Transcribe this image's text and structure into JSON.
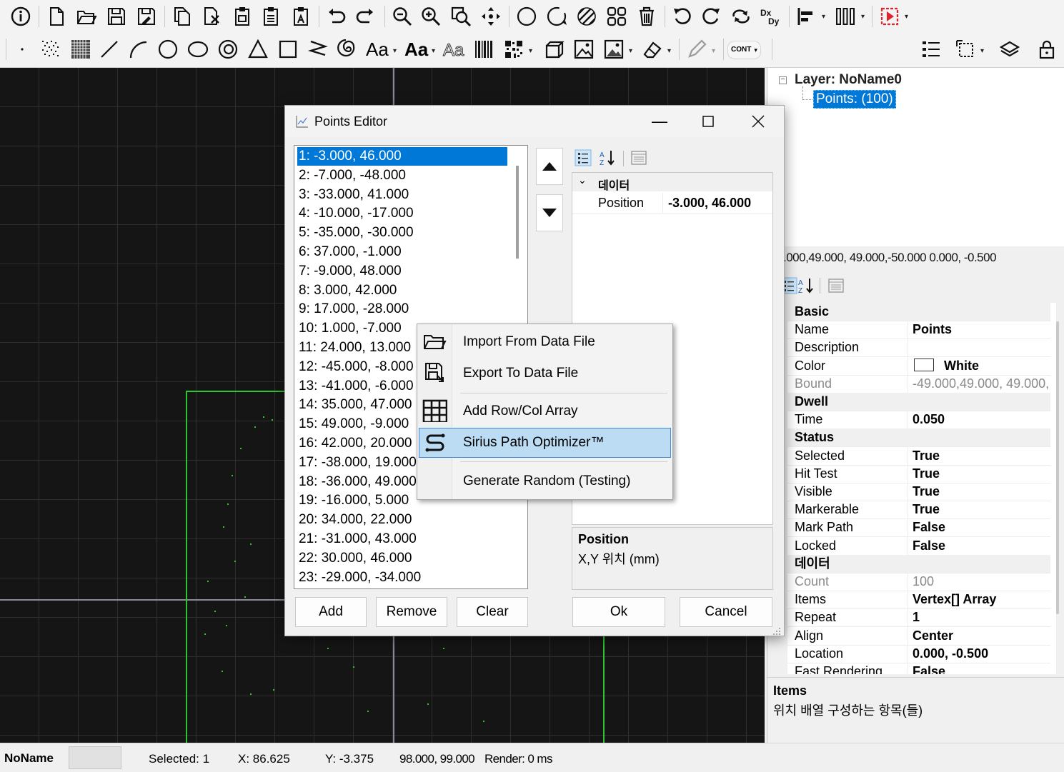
{
  "toolbar_top": {
    "icons": [
      "info-icon",
      "new-file-icon",
      "open-folder-icon",
      "save-icon",
      "save-as-icon",
      "copy-pages-icon",
      "cut-doc-icon",
      "paste-icon",
      "paste-special-icon",
      "paste-alt-icon",
      "undo-icon",
      "redo-icon",
      "zoom-out-icon",
      "zoom-in-icon",
      "zoom-fit-icon",
      "pan-icon",
      "circle-icon",
      "circle-dashed-icon",
      "hatch-icon",
      "group-icon",
      "delete-icon",
      "rotate-ccw-icon",
      "rotate-cw-icon",
      "swap-icon",
      "dxdy-icon",
      "align-left-icon",
      "distribute-icon",
      "marker-icon"
    ]
  },
  "toolbar_second": {
    "cont_label": "CONT",
    "text_tool_label": "Aa",
    "text_bold_label": "Aa",
    "text_outline_label": "Aa"
  },
  "layer_tree": {
    "layer_label": "Layer: NoName0",
    "entity_label": "Points: (100)"
  },
  "prop_header": {
    "text": ".000,49.000, 49.000,-50.000   0.000, -0.500"
  },
  "property_grid": {
    "rows": [
      {
        "name": "Basic",
        "category": true
      },
      {
        "name": "Name",
        "value": "Points"
      },
      {
        "name": "Description",
        "value": ""
      },
      {
        "name": "Color",
        "value": "White",
        "color": "#ffffff"
      },
      {
        "name": "Bound",
        "value": "-49.000,49.000, 49.000,",
        "dim": true
      },
      {
        "name": "Dwell",
        "category": true
      },
      {
        "name": "Time",
        "value": "0.050"
      },
      {
        "name": "Status",
        "category": true
      },
      {
        "name": "Selected",
        "value": "True"
      },
      {
        "name": "Hit Test",
        "value": "True"
      },
      {
        "name": "Visible",
        "value": "True"
      },
      {
        "name": "Markerable",
        "value": "True"
      },
      {
        "name": "Mark Path",
        "value": "False"
      },
      {
        "name": "Locked",
        "value": "False"
      },
      {
        "name": "데이터",
        "category": true
      },
      {
        "name": "Count",
        "value": "100",
        "dim": true
      },
      {
        "name": "Items",
        "value": "Vertex[] Array"
      },
      {
        "name": "Repeat",
        "value": "1"
      },
      {
        "name": "Align",
        "value": "Center"
      },
      {
        "name": "Location",
        "value": "0.000, -0.500"
      },
      {
        "name": "Fast Rendering",
        "value": "False"
      }
    ],
    "description_title": "Items",
    "description_text": "위치 배열 구성하는 항목(들)"
  },
  "status_bar": {
    "doc_name": "NoName",
    "selected": "Selected: 1",
    "x": "X: 86.625",
    "y": "Y: -3.375",
    "size": "98.000, 99.000",
    "render": "Render: 0 ms"
  },
  "dialog": {
    "title": "Points Editor",
    "points": [
      "1: -3.000, 46.000",
      "2: -7.000, -48.000",
      "3: -33.000, 41.000",
      "4: -10.000, -17.000",
      "5: -35.000, -30.000",
      "6: 37.000, -1.000",
      "7: -9.000, 48.000",
      "8: 3.000, 42.000",
      "9: 17.000, -28.000",
      "10: 1.000, -7.000",
      "11: 24.000, 13.000",
      "12: -45.000, -8.000",
      "13: -41.000, -6.000",
      "14: 35.000, 47.000",
      "15: 49.000, -9.000",
      "16: 42.000, 20.000",
      "17: -38.000, 19.000",
      "18: -36.000, 49.000",
      "19: -16.000, 5.000",
      "20: 34.000, 22.000",
      "21: -31.000, 43.000",
      "22: 30.000, 46.000",
      "23: -29.000, -34.000"
    ],
    "selected_index": 0,
    "inner_grid": {
      "category": "데이터",
      "prop_name": "Position",
      "prop_value": "-3.000, 46.000"
    },
    "inner_desc": {
      "title": "Position",
      "text": "X,Y 위치 (mm)"
    },
    "buttons": {
      "add": "Add",
      "remove": "Remove",
      "clear": "Clear",
      "ok": "Ok",
      "cancel": "Cancel"
    }
  },
  "context_menu": {
    "items": [
      {
        "label": "Import From Data File",
        "icon": "folder-open-icon"
      },
      {
        "label": "Export To Data File",
        "icon": "save-export-icon"
      },
      {
        "label": "Add Row/Col Array",
        "icon": "table-grid-icon"
      },
      {
        "label": "Sirius Path Optimizer™",
        "icon": "path-s-icon",
        "highlighted": true
      },
      {
        "label": "Generate Random (Testing)",
        "icon": ""
      }
    ]
  },
  "colors": {
    "selection": "#0078d7",
    "menu_highlight": "#bcdcf4",
    "bound_green": "#2ec62e",
    "canvas_bg": "#151515"
  }
}
